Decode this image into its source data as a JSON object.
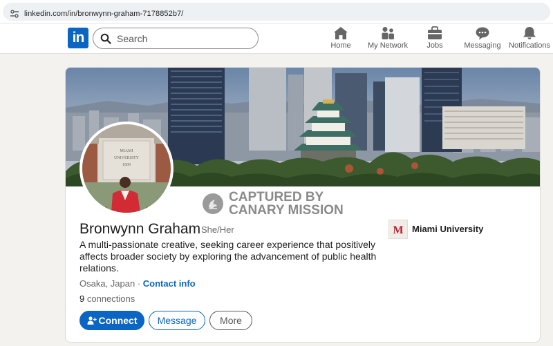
{
  "browser": {
    "url": "linkedin.com/in/bronwynn-graham-7178852b7/"
  },
  "nav": {
    "logo_text": "in",
    "search_placeholder": "Search",
    "items": [
      {
        "label": "Home",
        "icon": "home-icon"
      },
      {
        "label": "My Network",
        "icon": "network-icon"
      },
      {
        "label": "Jobs",
        "icon": "briefcase-icon"
      },
      {
        "label": "Messaging",
        "icon": "messaging-icon"
      },
      {
        "label": "Notifications",
        "icon": "bell-icon"
      }
    ]
  },
  "watermark": {
    "line1": "CAPTURED BY",
    "line2": "CANARY MISSION"
  },
  "profile": {
    "name": "Bronwynn Graham",
    "pronouns": "She/Her",
    "headline": "A multi-passionate creative, seeking career experience that positively affects broader society by exploring the advancement of public health relations.",
    "location": "Osaka, Japan",
    "separator": " · ",
    "contact_info": "Contact info",
    "connections_count": "9",
    "connections_label": " connections",
    "school": "Miami University",
    "school_logo_letter": "M",
    "avatar_sign_lines": [
      "MIAMI",
      "UNIVERSITY",
      "1809"
    ]
  },
  "actions": {
    "connect": "Connect",
    "message": "Message",
    "more": "More"
  },
  "colors": {
    "brand": "#0a66c2",
    "miami_red": "#b61e2e",
    "watermark_gray": "#8a8a8a"
  }
}
